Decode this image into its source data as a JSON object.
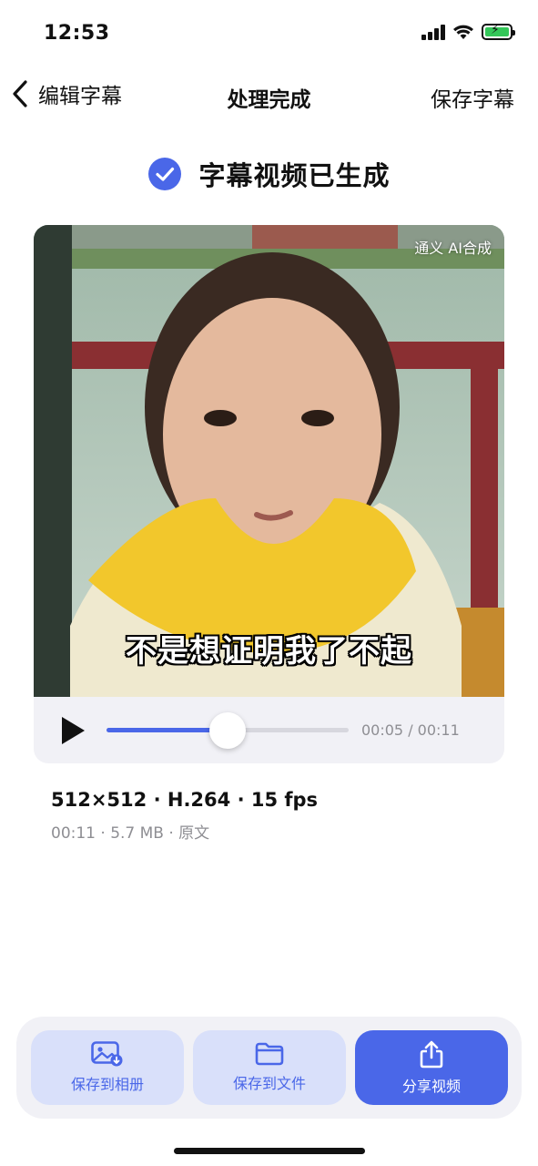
{
  "status_bar": {
    "time": "12:53",
    "icons": [
      "signal-icon",
      "wifi-icon",
      "battery-charging-icon"
    ],
    "battery_color": "#34c759"
  },
  "nav": {
    "back_label": "编辑字幕",
    "title": "处理完成",
    "save_label": "保存字幕",
    "back_icon": "chevron-left-icon"
  },
  "result": {
    "message": "字幕视频已生成",
    "icon": "checkmark-circle-icon",
    "accent": "#4a67e8"
  },
  "video": {
    "watermark": "通义 AI合成",
    "subtitle": "不是想证明我了不起",
    "progress_fraction": 0.5,
    "time_readout": "00:05 / 00:11"
  },
  "details": {
    "spec_line": "512×512  ·  H.264  ·  15 fps",
    "info_line": "00:11  ·  5.7 MB  ·  原文"
  },
  "actions": {
    "save_album": "保存到相册",
    "save_file": "保存到文件",
    "share": "分享视频"
  }
}
